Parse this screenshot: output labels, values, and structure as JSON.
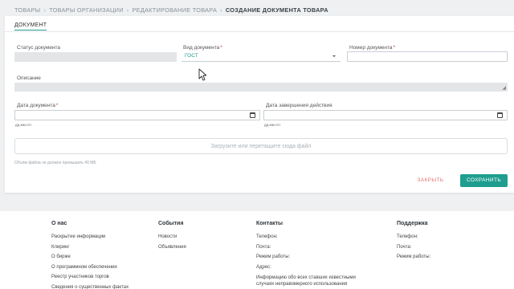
{
  "breadcrumb": {
    "items": [
      "ТОВАРЫ",
      "ТОВАРЫ ОРГАНИЗАЦИИ",
      "РЕДАКТИРОВАНИЕ ТОВАРА"
    ],
    "current": "СОЗДАНИЕ ДОКУМЕНТА ТОВАРА",
    "separator": "›"
  },
  "form": {
    "tab_label": "ДОКУМЕНТ",
    "status": {
      "label": "Статус документа",
      "value": ""
    },
    "doc_type": {
      "label": "Вид документа",
      "value": "ГОСТ"
    },
    "doc_number": {
      "label": "Номер документа",
      "value": ""
    },
    "description": {
      "label": "Описание",
      "value": ""
    },
    "doc_date": {
      "label": "Дата документа",
      "placeholder": "дд.мм.гггг"
    },
    "end_date": {
      "label": "Дата завершения действия",
      "placeholder": "дд.мм.гггг"
    },
    "required_mark": "*",
    "upload_text": "Загрузите или перетащите сюда файл",
    "upload_note": "Объём файла не должен превышать 40 МБ",
    "close_label": "ЗАКРЫТЬ",
    "save_label": "СОХРАНИТЬ"
  },
  "footer": {
    "about": {
      "title": "О нас",
      "links": [
        "Раскрытие информации",
        "Клиринг",
        "О бирже",
        "О программном обеспечении",
        "Реестр участников торгов",
        "Сведения о существенных фактах"
      ]
    },
    "events": {
      "title": "События",
      "links": [
        "Новости",
        "Объявления"
      ]
    },
    "contacts": {
      "title": "Контакты",
      "links": [
        "Телефон:",
        "Почта:",
        "Режим работы:",
        "Адрес:"
      ],
      "info_line1": "Информацию обо всех ставших известными",
      "info_line2": "случаях неправомерного использования"
    },
    "support": {
      "title": "Поддержка",
      "links": [
        "Телефон:",
        "Почта:",
        "Режим работы:"
      ]
    }
  },
  "colors": {
    "accent": "#1f9e8f",
    "close": "#e57373",
    "required": "#c0392b"
  },
  "icons": {
    "calendar": "calendar-icon",
    "dropdown": "chevron-down-icon",
    "resize": "resize-handle-icon",
    "cursor": "mouse-pointer-icon"
  }
}
